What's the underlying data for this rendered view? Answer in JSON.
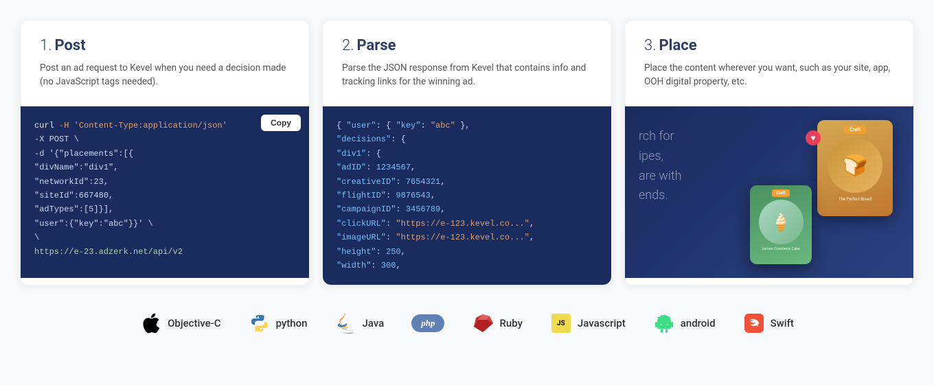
{
  "cards": [
    {
      "id": "post",
      "number": "1.",
      "title": "Post",
      "description": "Post an ad request to Kevel when you need a decision made (no JavaScript tags needed).",
      "copy_label": "Copy",
      "code_lines": [
        {
          "type": "curl",
          "content": "curl -H 'Content-Type:application/json'"
        },
        {
          "type": "plain",
          "content": "   -X POST \\"
        },
        {
          "type": "plain",
          "content": "   -d '{\"placements\":[{"
        },
        {
          "type": "plain",
          "content": "   \"divName\":\"div1\","
        },
        {
          "type": "plain",
          "content": "   \"networkId\":23,"
        },
        {
          "type": "plain",
          "content": "   \"siteId\":667480,"
        },
        {
          "type": "plain",
          "content": "   \"adTypes\":[5]}],"
        },
        {
          "type": "plain",
          "content": "   \"user\":{\"key\":\"abc\"}}' \\"
        },
        {
          "type": "plain",
          "content": "   \\"
        },
        {
          "type": "url",
          "content": "https://e-23.adzerk.net/api/v2"
        }
      ]
    },
    {
      "id": "parse",
      "number": "2.",
      "title": "Parse",
      "description": "Parse the JSON response from Kevel that contains info and tracking links for the winning ad.",
      "code_lines": [
        {
          "type": "json",
          "content": "{ \"user\": { \"key\": \"abc\" },"
        },
        {
          "type": "json",
          "content": "  \"decisions\": {"
        },
        {
          "type": "json",
          "content": "    \"div1\": {"
        },
        {
          "type": "json",
          "content": "      \"adID\": 1234567,"
        },
        {
          "type": "json",
          "content": "      \"creativeID\": 7654321,"
        },
        {
          "type": "json",
          "content": "      \"flightID\": 9876543,"
        },
        {
          "type": "json",
          "content": "      \"campaignID\": 3456789,"
        },
        {
          "type": "json",
          "content": "      \"clickURL\": \"https://e-123.kevel.co...\","
        },
        {
          "type": "json",
          "content": "      \"imageURL\": \"https://e-123.kevel.co...\","
        },
        {
          "type": "json",
          "content": "      \"height\": 250,"
        },
        {
          "type": "json",
          "content": "      \"width\": 300,"
        }
      ]
    },
    {
      "id": "place",
      "number": "3.",
      "title": "Place",
      "description": "Place the content wherever you want, such as your site, app, OOH digital property, etc."
    }
  ],
  "sdks": [
    {
      "id": "objc",
      "label": "Objective-C",
      "icon_type": "apple"
    },
    {
      "id": "python",
      "label": "python",
      "icon_type": "python"
    },
    {
      "id": "java",
      "label": "Java",
      "icon_type": "java"
    },
    {
      "id": "php",
      "label": "php",
      "icon_type": "php"
    },
    {
      "id": "ruby",
      "label": "Ruby",
      "icon_type": "ruby"
    },
    {
      "id": "javascript",
      "label": "Javascript",
      "icon_type": "js"
    },
    {
      "id": "android",
      "label": "android",
      "icon_type": "android"
    },
    {
      "id": "swift",
      "label": "Swift",
      "icon_type": "swift"
    }
  ]
}
